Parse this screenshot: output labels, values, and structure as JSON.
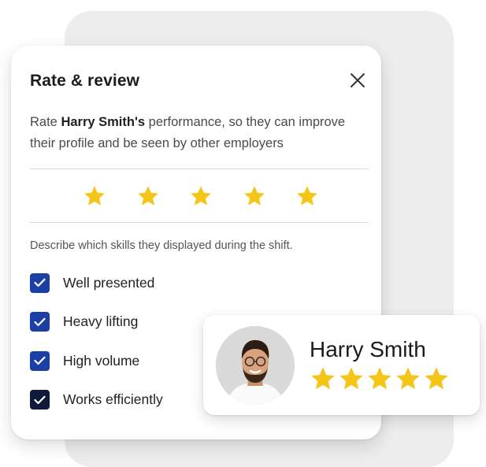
{
  "modal": {
    "title": "Rate & review",
    "description": {
      "before": "Rate ",
      "name": "Harry  Smith's",
      "after": " performance, so they can improve their profile and be seen by other employers"
    },
    "rating": {
      "value": 5,
      "max": 5,
      "star_color": "#f5c518"
    },
    "skills_prompt": "Describe which skills they displayed during the shift.",
    "skills": [
      {
        "label": "Well presented",
        "checked": true
      },
      {
        "label": "Heavy lifting",
        "checked": true
      },
      {
        "label": "High volume",
        "checked": true
      },
      {
        "label": "Works efficiently",
        "checked": true
      }
    ],
    "checkbox_color": "#1b3fa4"
  },
  "profile_card": {
    "name": "Harry Smith",
    "rating": 5,
    "star_color": "#f5c518"
  },
  "icons": {
    "close": "close-icon",
    "star": "star-icon",
    "check": "check-icon",
    "avatar": "avatar-photo"
  }
}
